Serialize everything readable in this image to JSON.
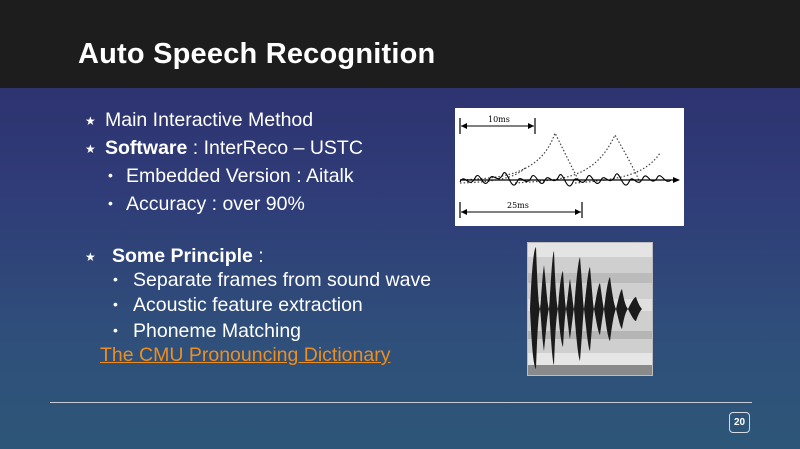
{
  "slide": {
    "title": "Auto Speech Recognition",
    "bullets": [
      {
        "text": "Main Interactive Method"
      },
      {
        "bold": "Software",
        "rest": " : InterReco – USTC"
      },
      {
        "text": "Embedded Version : Aitalk"
      },
      {
        "text": "Accuracy : over 90%"
      },
      {
        "bold": "Some Principle",
        "rest": " :"
      },
      {
        "text": "Separate frames from sound wave"
      },
      {
        "text": "Acoustic feature extraction"
      },
      {
        "text": "Phoneme Matching"
      }
    ],
    "link_text": "The CMU Pronouncing Dictionary",
    "page_number": "20"
  },
  "waveform_figure": {
    "label_top": "10ms",
    "label_bottom": "25ms"
  },
  "icons": {
    "bullet_primary": "star-icon",
    "bullet_secondary": "dot-icon"
  },
  "colors": {
    "title_bar": "#1d1d1d",
    "link": "#ee8e1e",
    "background_top": "#2d2c6a",
    "background_bottom": "#2d5678"
  }
}
